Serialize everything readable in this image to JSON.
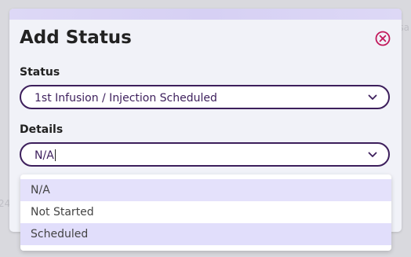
{
  "background": {
    "hint_right": "sa",
    "hint_left": "24"
  },
  "modal": {
    "title": "Add Status",
    "close_icon": "close-circle-icon",
    "accent_color": "#c2185b"
  },
  "status_field": {
    "label": "Status",
    "value": "1st Infusion / Injection Scheduled"
  },
  "details_field": {
    "label": "Details",
    "value": "N/A"
  },
  "details_options": [
    {
      "label": "N/A",
      "state": "selected"
    },
    {
      "label": "Not Started",
      "state": "normal"
    },
    {
      "label": "Scheduled",
      "state": "hover"
    }
  ]
}
